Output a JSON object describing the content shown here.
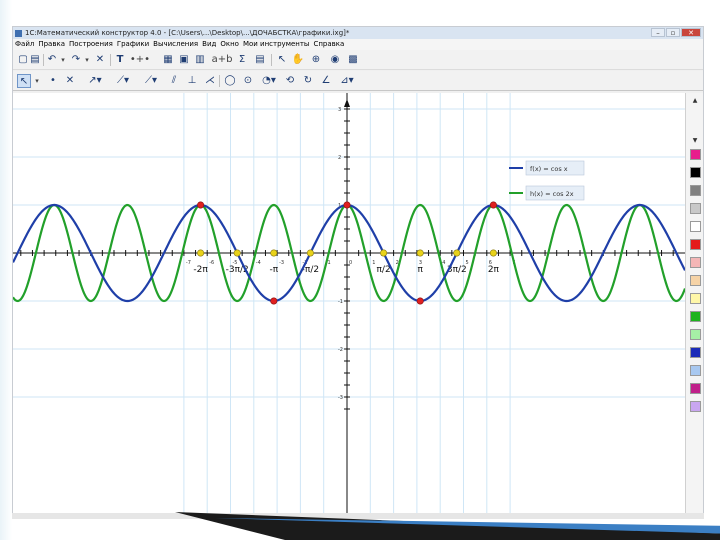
{
  "window": {
    "title": "1С:Математический конструктор 4.0 - [C:\\Users\\...\\Desktop\\...\\ДОЧАБСТКА\\графики.ixg]*",
    "controls": {
      "minimize": "–",
      "restore": "▫",
      "close": "✕"
    }
  },
  "menu": [
    "Файл",
    "Правка",
    "Построения",
    "Графики",
    "Вычисления",
    "Вид",
    "Окно",
    "Мои инструменты",
    "Справка"
  ],
  "colors": {
    "cos_x": "#1f3fa8",
    "cos_2x": "#22a02a",
    "grid": "#cfe6f6",
    "axis": "#111111",
    "red_point": "#e02020",
    "yellow_point": "#e8d21a"
  },
  "legend": [
    {
      "label": "f(x) = cos x",
      "color": "#1f3fa8"
    },
    {
      "label": "h(x) = cos 2x",
      "color": "#22a02a"
    }
  ],
  "axis_labels": {
    "x": [
      "-2π",
      "-3π/2",
      "-π",
      "-π/2",
      "π/2",
      "π",
      "3π/2",
      "2π"
    ],
    "small_x": [
      "-7",
      "-6",
      "-5",
      "-4",
      "-3",
      "-2",
      "-1",
      "0",
      "1",
      "2",
      "3",
      "4",
      "5",
      "6",
      "7"
    ],
    "small_y": [
      "3",
      "2",
      "1",
      "-1",
      "-2",
      "-3"
    ]
  },
  "palette": [
    "#e81e8c",
    "#000000",
    "#808080",
    "#c8c8c8",
    "#ffffff",
    "#e51b1b",
    "#f4b6b6",
    "#f6d3a6",
    "#fff7a8",
    "#1db31d",
    "#a6f0a6",
    "#1a2ab8",
    "#a8c8f0",
    "#c0208a",
    "#c9a6f0"
  ],
  "chart_data": {
    "type": "line",
    "xlim": [
      -7.2,
      7.2
    ],
    "ylim": [
      -3.4,
      3.2
    ],
    "series": [
      {
        "name": "f(x) = cos x",
        "formula": "cos x"
      },
      {
        "name": "h(x) = cos 2x",
        "formula": "cos 2x"
      }
    ],
    "red_points": [
      [
        -6.2832,
        1
      ],
      [
        -3.1416,
        -1
      ],
      [
        0,
        1
      ],
      [
        3.1416,
        -1
      ],
      [
        6.2832,
        1
      ]
    ],
    "yellow_points": [
      [
        -6.2832,
        0
      ],
      [
        -4.7124,
        0
      ],
      [
        -3.1416,
        0
      ],
      [
        -1.5708,
        0
      ],
      [
        1.5708,
        0
      ],
      [
        3.1416,
        0
      ],
      [
        4.7124,
        0
      ],
      [
        6.2832,
        0
      ]
    ],
    "x_ticks": [
      -6.2832,
      -4.7124,
      -3.1416,
      -1.5708,
      1.5708,
      3.1416,
      4.7124,
      6.2832
    ],
    "grid": true
  }
}
